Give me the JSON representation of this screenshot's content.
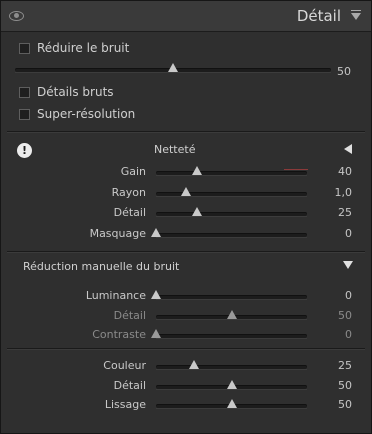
{
  "header": {
    "title": "Détail"
  },
  "top": {
    "reduce_noise": {
      "label": "Réduire le bruit",
      "checked": false
    },
    "master_slider": {
      "value": 50,
      "value_text": "50",
      "fraction": 0.5
    },
    "raw_details": {
      "label": "Détails bruts",
      "checked": false
    },
    "super_resolution": {
      "label": "Super-résolution",
      "checked": false
    }
  },
  "sharpening": {
    "title": "Netteté",
    "rows": [
      {
        "label": "Gain",
        "value_text": "40",
        "fraction": 0.27
      },
      {
        "label": "Rayon",
        "value_text": "1,0",
        "fraction": 0.2
      },
      {
        "label": "Détail",
        "value_text": "25",
        "fraction": 0.27
      },
      {
        "label": "Masquage",
        "value_text": "0",
        "fraction": 0.0
      }
    ]
  },
  "noise_reduction": {
    "title": "Réduction manuelle du bruit",
    "luminance_rows": [
      {
        "label": "Luminance",
        "value_text": "0",
        "fraction": 0.0,
        "dim": false
      },
      {
        "label": "Détail",
        "value_text": "50",
        "fraction": 0.5,
        "dim": true
      },
      {
        "label": "Contraste",
        "value_text": "0",
        "fraction": 0.0,
        "dim": true
      }
    ],
    "color_rows": [
      {
        "label": "Couleur",
        "value_text": "25",
        "fraction": 0.25,
        "dim": false
      },
      {
        "label": "Détail",
        "value_text": "50",
        "fraction": 0.5,
        "dim": false
      },
      {
        "label": "Lissage",
        "value_text": "50",
        "fraction": 0.5,
        "dim": false
      }
    ]
  }
}
